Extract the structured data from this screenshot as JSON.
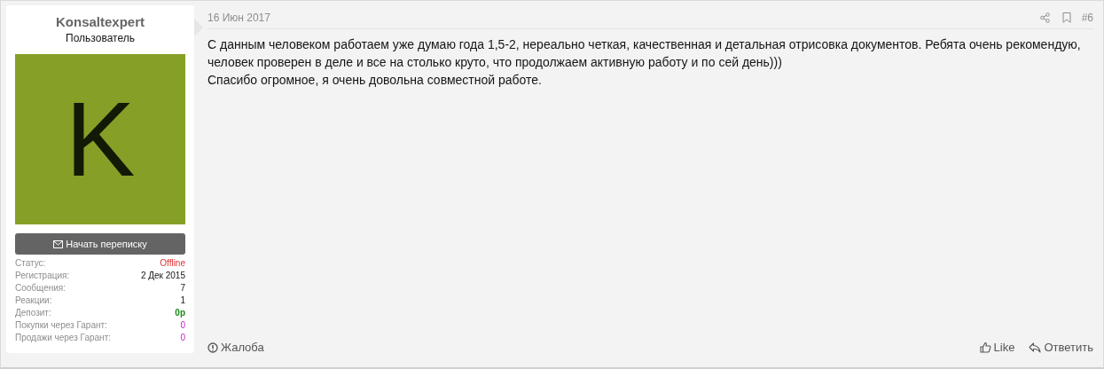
{
  "user": {
    "name": "Konsaltexpert",
    "role": "Пользователь",
    "avatar_letter": "K"
  },
  "message_button": "Начать переписку",
  "stats": [
    {
      "label": "Статус:",
      "value": "Offline",
      "kind": "status"
    },
    {
      "label": "Регистрация:",
      "value": "2 Дек 2015",
      "kind": "plain"
    },
    {
      "label": "Сообщения:",
      "value": "7",
      "kind": "plain"
    },
    {
      "label": "Реакции:",
      "value": "1",
      "kind": "plain"
    },
    {
      "label": "Депозит:",
      "value": "0р",
      "kind": "money"
    },
    {
      "label": "Покупки через Гарант:",
      "value": "0",
      "kind": "guarantee"
    },
    {
      "label": "Продажи через Гарант:",
      "value": "0",
      "kind": "guarantee"
    }
  ],
  "post": {
    "date": "16 Июн 2017",
    "number": "#6",
    "paragraphs": [
      "С данным человеком работаем уже думаю года 1,5-2, нереально четкая, качественная и детальная отрисовка документов. Ребята очень рекомендую, человек проверен в деле и все на столько круто, что продолжаем активную работу и по сей день)))",
      "Спасибо огромное, я очень довольна совместной работе."
    ],
    "report": "Жалоба",
    "like": "Like",
    "reply": "Ответить"
  }
}
